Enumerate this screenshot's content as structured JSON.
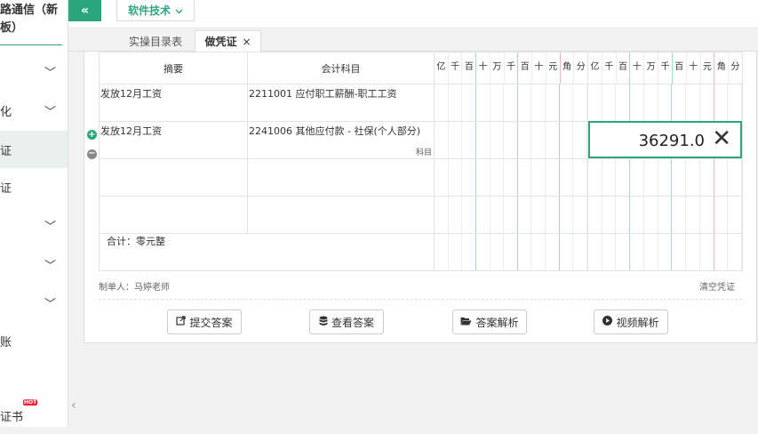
{
  "sidebar": {
    "brand_line1": "路通信（新",
    "brand_line2": "板）",
    "items": [
      {
        "label": "",
        "chevron": "﹀"
      },
      {
        "label": "化",
        "chevron": "﹀"
      },
      {
        "label": "证",
        "chevron": ""
      },
      {
        "label": "证",
        "chevron": ""
      },
      {
        "label": "",
        "chevron": "﹀"
      },
      {
        "label": "",
        "chevron": "﹀"
      },
      {
        "label": "",
        "chevron": "﹀"
      },
      {
        "label": "账",
        "chevron": ""
      },
      {
        "label": "",
        "chevron": ""
      },
      {
        "label": "证书",
        "chevron": "",
        "badge": "HOT"
      }
    ],
    "collapse_glyph": "‹"
  },
  "topbar": {
    "toggle_glyph": "«",
    "menu_label": "软件技术"
  },
  "tabs": [
    {
      "label": "实操目录表"
    },
    {
      "label": "做凭证",
      "close": "×"
    }
  ],
  "voucher": {
    "col_summary": "摘要",
    "col_subject": "会计科目",
    "digits": [
      "亿",
      "千",
      "百",
      "十",
      "万",
      "千",
      "百",
      "十",
      "元",
      "角",
      "分"
    ],
    "rows": [
      {
        "summary": "发放12月工资",
        "subject": "2211001 应付职工薪酬-职工工资",
        "hint": ""
      },
      {
        "summary": "发放12月工资",
        "subject": "2241006 其他应付款 - 社保(个人部分)",
        "hint": "科目"
      },
      {
        "summary": "",
        "subject": "",
        "hint": ""
      },
      {
        "summary": "",
        "subject": "",
        "hint": ""
      }
    ],
    "total_label": "合计：零元整",
    "amount_input_value": "36291.0",
    "clear_glyph": "✕",
    "add_row_glyph": "+",
    "del_row_glyph": "−"
  },
  "footer": {
    "maker": "制单人：马婷老师",
    "clear": "清空凭证"
  },
  "buttons": {
    "submit": "提交答案",
    "view": "查看答案",
    "analysis": "答案解析",
    "video": "视频解析"
  }
}
